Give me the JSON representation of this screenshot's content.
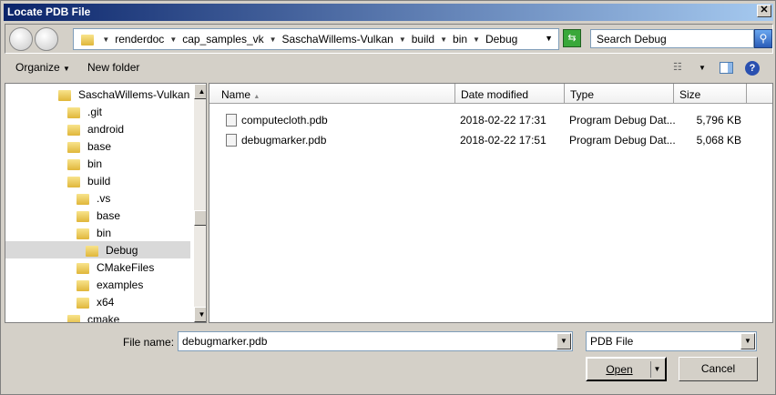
{
  "window": {
    "title": "Locate PDB File",
    "close": "✕"
  },
  "address": {
    "crumbs": [
      "renderdoc",
      "cap_samples_vk",
      "SaschaWillems-Vulkan",
      "build",
      "bin",
      "Debug"
    ],
    "search_placeholder": "Search Debug"
  },
  "toolbar": {
    "organize": "Organize",
    "new_folder": "New folder"
  },
  "tree": [
    {
      "label": "SaschaWillems-Vulkan",
      "level": 0
    },
    {
      "label": ".git",
      "level": 1
    },
    {
      "label": "android",
      "level": 1
    },
    {
      "label": "base",
      "level": 1
    },
    {
      "label": "bin",
      "level": 1
    },
    {
      "label": "build",
      "level": 1
    },
    {
      "label": ".vs",
      "level": 2
    },
    {
      "label": "base",
      "level": 2
    },
    {
      "label": "bin",
      "level": 2
    },
    {
      "label": "Debug",
      "level": 3,
      "selected": true
    },
    {
      "label": "CMakeFiles",
      "level": 2
    },
    {
      "label": "examples",
      "level": 2
    },
    {
      "label": "x64",
      "level": 2
    },
    {
      "label": "cmake",
      "level": 1
    }
  ],
  "columns": {
    "name": "Name",
    "date": "Date modified",
    "type": "Type",
    "size": "Size"
  },
  "files": [
    {
      "name": "computecloth.pdb",
      "date": "2018-02-22 17:31",
      "type": "Program Debug Dat...",
      "size": "5,796 KB"
    },
    {
      "name": "debugmarker.pdb",
      "date": "2018-02-22 17:51",
      "type": "Program Debug Dat...",
      "size": "5,068 KB"
    }
  ],
  "footer": {
    "file_name_label": "File name:",
    "file_name_value": "debugmarker.pdb",
    "filter": "PDB File",
    "open": "Open",
    "cancel": "Cancel"
  }
}
